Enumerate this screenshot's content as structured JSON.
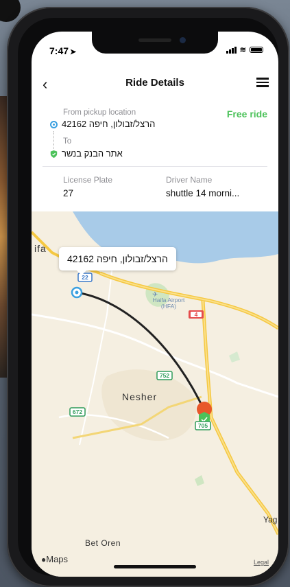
{
  "status": {
    "time": "7:47"
  },
  "header": {
    "title": "Ride Details"
  },
  "route": {
    "from_label": "From pickup location",
    "from_address": "הרצל/זבולון, חיפה 42162",
    "to_label": "To",
    "to_address": "אתר הבנק בנשר",
    "price_label": "Free ride"
  },
  "details": {
    "license_plate_label": "License Plate",
    "license_plate": "27",
    "driver_name_label": "Driver Name",
    "driver_name": "shuttle 14 morni..."
  },
  "map": {
    "callout": "הרצל/זבולון, חיפה 42162",
    "labels": {
      "haifa": "ifa",
      "nesher": "Nesher",
      "bet_oren": "Bet Oren",
      "yagur": "Yag",
      "airport": "Haifa Airport (HFA)"
    },
    "road_shields": [
      "22",
      "4",
      "752",
      "672",
      "705"
    ],
    "attribution": "Maps",
    "legal": "Legal"
  },
  "colors": {
    "accent_green": "#4cc25a",
    "route_line": "#222222",
    "pickup_blue": "#3aa0e0",
    "driver_orange": "#e8582a"
  }
}
